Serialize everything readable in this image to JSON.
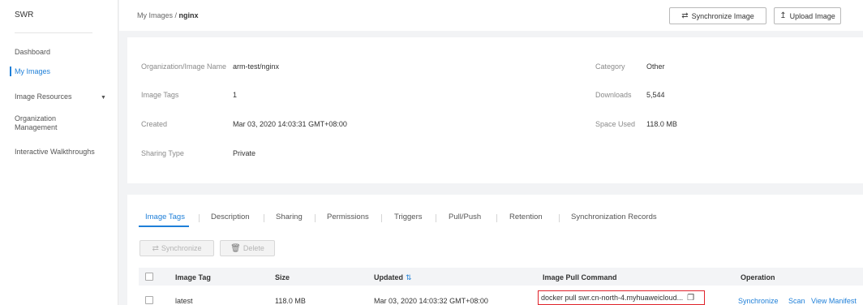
{
  "sidebar": {
    "brand": "SWR",
    "items": [
      {
        "label": "Dashboard"
      },
      {
        "label": "My Images"
      },
      {
        "label": "Image Resources"
      },
      {
        "label": "Organization\nManagement"
      },
      {
        "label": "Interactive Walkthroughs"
      }
    ],
    "active_color": "#1e7fd8"
  },
  "header": {
    "breadcrumb_parent": "My Images",
    "breadcrumb_sep": " / ",
    "breadcrumb_current": "nginx",
    "sync_button": "Synchronize Image",
    "upload_button": "Upload Image"
  },
  "info": {
    "org_image_label": "Organization/Image Name",
    "org_image_value": "arm-test/nginx",
    "image_tags_label": "Image Tags",
    "image_tags_value": "1",
    "created_label": "Created",
    "created_value": "Mar 03, 2020 14:03:31 GMT+08:00",
    "sharing_type_label": "Sharing Type",
    "sharing_type_value": "Private",
    "category_label": "Category",
    "category_value": "Other",
    "downloads_label": "Downloads",
    "downloads_value": "5,544",
    "space_used_label": "Space Used",
    "space_used_value": "118.0 MB"
  },
  "tabs": [
    {
      "label": "Image Tags"
    },
    {
      "label": "Description"
    },
    {
      "label": "Sharing"
    },
    {
      "label": "Permissions"
    },
    {
      "label": "Triggers"
    },
    {
      "label": "Pull/Push"
    },
    {
      "label": "Retention"
    },
    {
      "label": "Synchronization Records"
    }
  ],
  "actions": {
    "synchronize": "Synchronize",
    "delete": "Delete"
  },
  "table": {
    "columns": {
      "image_tag": "Image Tag",
      "size": "Size",
      "updated": "Updated",
      "pull_command": "Image Pull Command",
      "operation": "Operation"
    },
    "rows": [
      {
        "image_tag": "latest",
        "size": "118.0 MB",
        "updated": "Mar 03, 2020 14:03:32 GMT+08:00",
        "pull_command": "docker pull swr.cn-north-4.myhuaweicloud...",
        "ops": [
          "Synchronize",
          "Scan",
          "View Manifest"
        ]
      }
    ]
  },
  "colors": {
    "accent": "#1e7fd8",
    "highlight_border": "#e0232b"
  }
}
